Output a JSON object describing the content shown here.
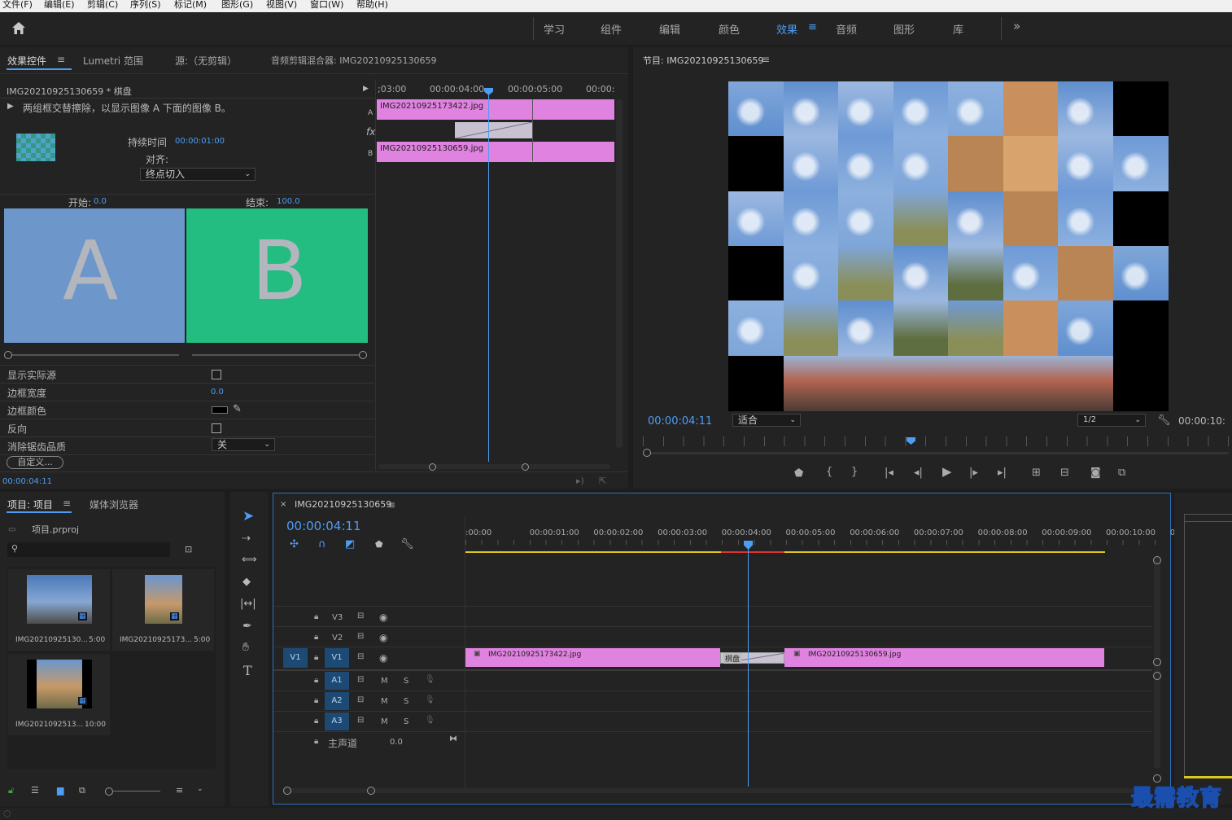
{
  "menu": [
    "文件(F)",
    "编辑(E)",
    "剪辑(C)",
    "序列(S)",
    "标记(M)",
    "图形(G)",
    "视图(V)",
    "窗口(W)",
    "帮助(H)"
  ],
  "workspaces": [
    "学习",
    "组件",
    "编辑",
    "颜色",
    "效果",
    "音频",
    "图形",
    "库"
  ],
  "workspaces_more": "»",
  "effect_panel": {
    "tabs": {
      "effect_controls": "效果控件",
      "lumetri": "Lumetri 范围",
      "source": "源:（无剪辑）",
      "audio_mixer": "音频剪辑混合器: IMG20210925130659"
    },
    "clip_header": "IMG20210925130659 * 棋盘",
    "description": "两组框交替擦除，以显示图像 A 下面的图像 B。",
    "duration_label": "持续时间",
    "duration_value": "00:00:01:00",
    "align_label": "对齐:",
    "align_value": "终点切入",
    "start_label": "开始:",
    "start_value": "0.0",
    "end_label": "结束:",
    "end_value": "100.0",
    "preview_a": "A",
    "preview_b": "B",
    "props": [
      {
        "label": "显示实际源"
      },
      {
        "label": "边框宽度",
        "value": "0.0"
      },
      {
        "label": "边框颜色"
      },
      {
        "label": "反向"
      },
      {
        "label": "消除锯齿品质",
        "value": "关"
      }
    ],
    "custom_button": "自定义...",
    "timecode": "00:00:04:11",
    "mini_ruler": [
      ";03:00",
      "00:00:04:00",
      "00:00:05:00",
      "00:00:"
    ],
    "track_a": "A",
    "track_b": "B",
    "fx": "fx",
    "clip_a": "IMG20210925173422.jpg",
    "clip_b": "IMG20210925130659.jpg"
  },
  "program": {
    "title": "节目: IMG20210925130659",
    "timecode": "00:00:04:11",
    "fit": "适合",
    "resolution": "1/2",
    "duration": "00:00:10:"
  },
  "project": {
    "tabs": {
      "project": "项目: 项目",
      "media": "媒体浏览器"
    },
    "file": "项目.prproj",
    "items": [
      {
        "name": "IMG20210925130...",
        "dur": "5:00"
      },
      {
        "name": "IMG20210925173...",
        "dur": "5:00"
      },
      {
        "name": "IMG2021092513...",
        "dur": "10:00"
      }
    ]
  },
  "timeline": {
    "tab": "IMG20210925130659",
    "timecode": "00:00:04:11",
    "ruler": [
      ":00:00",
      "00:00:01:00",
      "00:00:02:00",
      "00:00:03:00",
      "00:00:04:00",
      "00:00:05:00",
      "00:00:06:00",
      "00:00:07:00",
      "00:00:08:00",
      "00:00:09:00",
      "00:00:10:00",
      "0"
    ],
    "video_tracks": [
      "V3",
      "V2",
      "V1"
    ],
    "source_patch": "V1",
    "audio_tracks": [
      "A1",
      "A2",
      "A3"
    ],
    "m": "M",
    "s": "S",
    "master_label": "主声道",
    "master_value": "0.0",
    "clip1": "IMG20210925173422.jpg",
    "transition": "棋盘",
    "clip2": "IMG20210925130659.jpg"
  },
  "watermark": "最需教育"
}
